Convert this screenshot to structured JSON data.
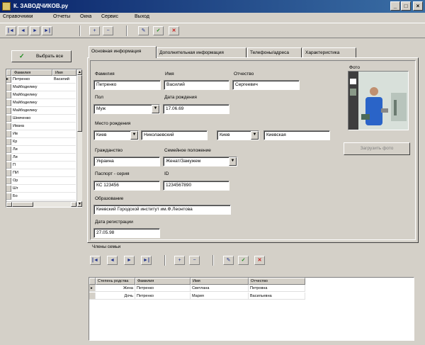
{
  "window": {
    "title": "К. ЗАВОДЧИКОВ.ру",
    "buttons": {
      "minimize": "_",
      "maximize": "□",
      "close": "×"
    }
  },
  "menu": [
    "Справочники",
    "Отчеты",
    "Окна",
    "Сервис",
    "Выход"
  ],
  "toolbar": {
    "nav": [
      "|◄",
      "◄",
      "►",
      "►|"
    ],
    "edit": [
      "+",
      "−"
    ],
    "actions": {
      "edit": "✎",
      "ok": "✓",
      "cancel": "✕"
    }
  },
  "left_panel": {
    "button_label": "Выбрать все",
    "columns": [
      "Фамилия",
      "Имя"
    ],
    "rows": [
      {
        "surname": "Петренко",
        "name": "Василий"
      },
      {
        "surname": "Майбоделику",
        "name": ""
      },
      {
        "surname": "Майбоделику",
        "name": ""
      },
      {
        "surname": "Майбоделику",
        "name": ""
      },
      {
        "surname": "Майбоделику",
        "name": ""
      },
      {
        "surname": "Шевченко",
        "name": ""
      },
      {
        "surname": "Ивана",
        "name": ""
      },
      {
        "surname": "Ив",
        "name": ""
      },
      {
        "surname": "Кр",
        "name": ""
      },
      {
        "surname": "Ли",
        "name": ""
      },
      {
        "surname": "Ли",
        "name": ""
      },
      {
        "surname": "П",
        "name": ""
      },
      {
        "surname": "ПИ",
        "name": ""
      },
      {
        "surname": "Ор",
        "name": ""
      },
      {
        "surname": "Шт",
        "name": ""
      },
      {
        "surname": "Бо",
        "name": ""
      }
    ]
  },
  "tabs": [
    "Основная информация",
    "Дополнительная информация",
    "Телефоны/адреса",
    "Характеристика"
  ],
  "form": {
    "surname": {
      "label": "Фамилия",
      "value": "Петренко"
    },
    "name": {
      "label": "Имя",
      "value": "Василий"
    },
    "patronymic": {
      "label": "Отчество",
      "value": "Сергеевич"
    },
    "sex": {
      "label": "Пол",
      "value": "Муж"
    },
    "birth_date": {
      "label": "Дата рождения",
      "value": "17.06.69"
    },
    "birth_place_label": "Место рождения",
    "birth_place": [
      "Киев",
      "Николаевский",
      "Киев",
      "Киевская"
    ],
    "citizenship": {
      "label": "Гражданство",
      "value": "Украина"
    },
    "education": {
      "label": "Семейное положение",
      "value": "Женат/Замужем"
    },
    "passport": {
      "label": "Паспорт - серия",
      "value": "КС 123456"
    },
    "id": {
      "label": "ID",
      "value": "1234567890"
    },
    "occupation": {
      "label": "Образование",
      "value": "Киевский Городской институт им.Ф.Леонтова"
    },
    "reg_date": {
      "label": "Дата регистрации",
      "value": "27.05.98"
    },
    "photo_label": "Фото",
    "photo_button": "Загрузить фото"
  },
  "relatives": {
    "section_label": "Члены семьи",
    "columns": [
      "Степень родства",
      "Фамилия",
      "Имя",
      "Отчество"
    ],
    "rows": [
      {
        "relation": "Жена",
        "surname": "Петренко",
        "name": "Светлана",
        "patronymic": "Петровна"
      },
      {
        "relation": "Дочь",
        "surname": "Петренко",
        "name": "Мария",
        "patronymic": "Васильевна"
      }
    ]
  }
}
